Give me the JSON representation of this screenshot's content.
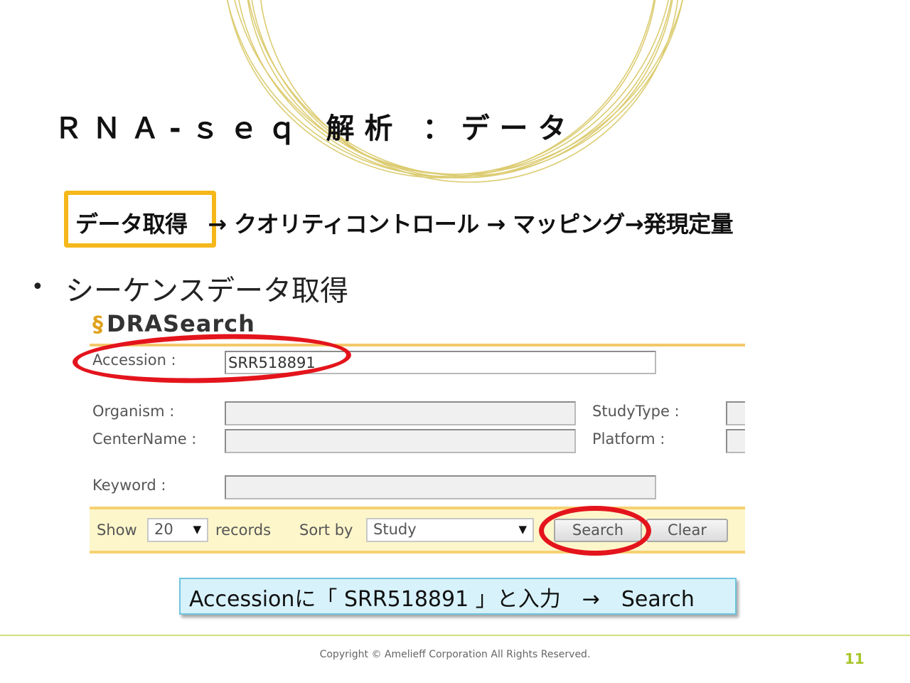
{
  "slide": {
    "title": "ＲＮＡ-ｓｅｑ 解析 ：データ",
    "workflow": {
      "current_step": "データ取得",
      "rest": "→ クオリティコントロール → マッピング→発現定量"
    },
    "bullet": "シーケンスデータ取得"
  },
  "drasearch": {
    "logo_text": "DRASearch",
    "accession_label": "Accession :",
    "accession_value": "SRR518891",
    "organism_label": "Organism :",
    "organism_value": "",
    "centername_label": "CenterName :",
    "centername_value": "",
    "studytype_label": "StudyType :",
    "platform_label": "Platform :",
    "keyword_label": "Keyword :",
    "keyword_value": "",
    "show_label": "Show",
    "show_value": "20",
    "records_label": "records",
    "sortby_label": "Sort by",
    "sortby_value": "Study",
    "search_button": "Search",
    "clear_button": "Clear"
  },
  "callout": "Accessionに「 SRR518891 」と入力　→　Search",
  "footer": {
    "copyright": "Copyright © Amelieff Corporation All Rights Reserved.",
    "page_number": "11"
  },
  "colors": {
    "highlight_box": "#f5b71a",
    "red_circle": "#e4141c",
    "search_bar_bg": "#fdf6cb",
    "callout_bg": "#d7f2fb",
    "page_number": "#a8c62a"
  }
}
